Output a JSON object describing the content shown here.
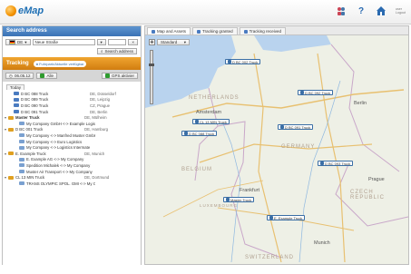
{
  "app": {
    "logo_text": "eMap"
  },
  "header": {
    "icons": [
      "people-icon",
      "help-icon",
      "home-icon"
    ],
    "user_line1": "user",
    "user_line2": "Logout"
  },
  "search_address": {
    "title": "Search address",
    "country": "DE",
    "street_value": "Neue Straße",
    "search_button": "Search address"
  },
  "tracking": {
    "title": "Tracking",
    "pill": "Fuhrpark/Aktuelle verfügbar",
    "date_value": "06.05.12",
    "all_label": "Alle",
    "gps_button": "GPS aktivier"
  },
  "tree": {
    "tab_label": "Today",
    "rows": [
      {
        "name": "D BC 088 Truck",
        "loc": "DE, Düsseldorf",
        "indent": 1,
        "icon": "truck",
        "bold": false,
        "toggle": ""
      },
      {
        "name": "D BC 089 Truck",
        "loc": "DE, Leipzig",
        "indent": 1,
        "icon": "truck",
        "bold": false,
        "toggle": ""
      },
      {
        "name": "D BC 090 Truck",
        "loc": "CZ, Prague",
        "indent": 1,
        "icon": "truck",
        "bold": false,
        "toggle": ""
      },
      {
        "name": "D BC 091 Truck",
        "loc": "DE, Berlin",
        "indent": 1,
        "icon": "truck",
        "bold": false,
        "toggle": ""
      },
      {
        "name": "Master Truck",
        "loc": "DE, Mülheim",
        "indent": 0,
        "icon": "truck-y",
        "bold": true,
        "toggle": "▾"
      },
      {
        "name": "My Company GmbH <-> Example Logistics",
        "loc": "",
        "indent": 2,
        "icon": "link",
        "bold": false,
        "toggle": ""
      },
      {
        "name": "D BC 001 Truck",
        "loc": "DE, Hamburg",
        "indent": 0,
        "icon": "truck-y",
        "bold": false,
        "toggle": "▾"
      },
      {
        "name": "My Company <-> Manfred Muster GmbH",
        "loc": "",
        "indent": 2,
        "icon": "link",
        "bold": false,
        "toggle": ""
      },
      {
        "name": "My Company <-> Euro Logistics",
        "loc": "",
        "indent": 2,
        "icon": "link",
        "bold": false,
        "toggle": ""
      },
      {
        "name": "My Company <-> Logistics Intermate",
        "loc": "",
        "indent": 2,
        "icon": "link",
        "bold": false,
        "toggle": ""
      },
      {
        "name": "E. Example Truck",
        "loc": "DE, Munich",
        "indent": 0,
        "icon": "truck-y",
        "bold": false,
        "toggle": "▾"
      },
      {
        "name": "E. Example AG <-> My Company",
        "loc": "",
        "indent": 2,
        "icon": "link",
        "bold": false,
        "toggle": ""
      },
      {
        "name": "Spedition Michalek <-> My Company",
        "loc": "",
        "indent": 2,
        "icon": "link",
        "bold": false,
        "toggle": ""
      },
      {
        "name": "Muster Air Transport <-> My Company",
        "loc": "",
        "indent": 2,
        "icon": "link",
        "bold": false,
        "toggle": ""
      },
      {
        "name": "CL 13 MIN Truck",
        "loc": "DE, Dortmund",
        "indent": 0,
        "icon": "truck-y",
        "bold": false,
        "toggle": "▾"
      },
      {
        "name": "TRANS OLYMPIC SPOL. GMI <-> My Company",
        "loc": "",
        "indent": 2,
        "icon": "link",
        "bold": false,
        "toggle": ""
      }
    ]
  },
  "map_tabs": [
    {
      "label": "Map and Assets",
      "active": true
    },
    {
      "label": "Tracking granted",
      "active": false
    },
    {
      "label": "Tracking received",
      "active": false
    }
  ],
  "map": {
    "layer_select": "Standard",
    "countries": [
      {
        "label": "NETHERLANDS"
      },
      {
        "label": "GERMANY"
      },
      {
        "label": "BELGIUM"
      },
      {
        "label": "LUXEMBOURG"
      },
      {
        "label": "CZECH REPUBLIC"
      },
      {
        "label": "SWITZERLAND"
      }
    ],
    "cities": [
      {
        "label": "Amsterdam"
      },
      {
        "label": "Berlin"
      },
      {
        "label": "Prague"
      },
      {
        "label": "Frankfurt"
      },
      {
        "label": "Munich"
      }
    ],
    "markers": [
      {
        "label": "D BC 002 Truck"
      },
      {
        "label": "D BC 092 Truck"
      },
      {
        "label": "CL 13 MIN Truck"
      },
      {
        "label": "D BC 091 Truck"
      },
      {
        "label": "D BC 088 Truck"
      },
      {
        "label": "D BC 093 Truck"
      },
      {
        "label": "Master Truck"
      },
      {
        "label": "E. Example Truck"
      }
    ]
  }
}
